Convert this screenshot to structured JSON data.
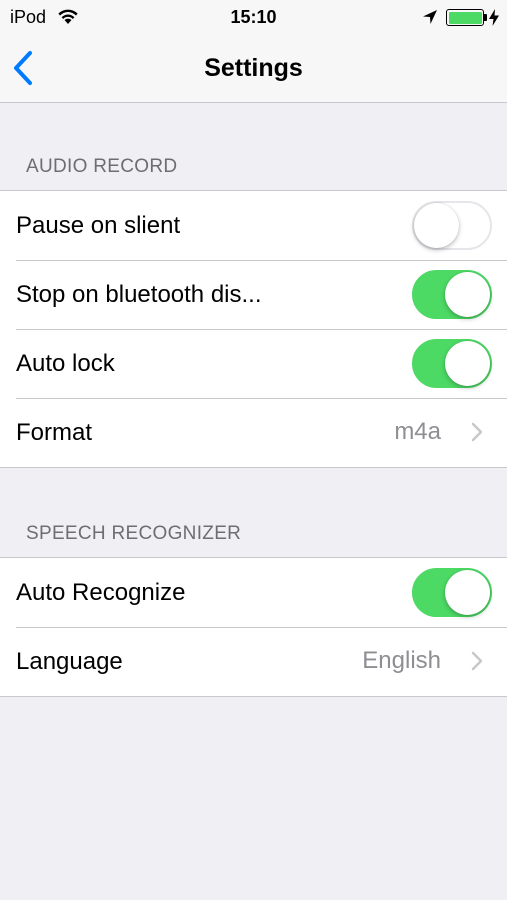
{
  "status_bar": {
    "carrier": "iPod",
    "time": "15:10",
    "battery_color": "#4cd964"
  },
  "nav": {
    "title": "Settings",
    "back_icon": "chevron-left-icon",
    "accent_color": "#007aff"
  },
  "sections": {
    "audio": {
      "header": "AUDIO RECORD",
      "rows": [
        {
          "label": "Pause on slient",
          "type": "toggle",
          "on": false
        },
        {
          "label": "Stop on bluetooth dis...",
          "type": "toggle",
          "on": true
        },
        {
          "label": "Auto lock",
          "type": "toggle",
          "on": true
        },
        {
          "label": "Format",
          "type": "disclosure",
          "value": "m4a"
        }
      ]
    },
    "speech": {
      "header": "SPEECH RECOGNIZER",
      "rows": [
        {
          "label": "Auto Recognize",
          "type": "toggle",
          "on": true
        },
        {
          "label": "Language",
          "type": "disclosure",
          "value": "English"
        }
      ]
    }
  },
  "colors": {
    "toggle_on": "#4cd964",
    "background": "#efeff4",
    "separator": "#c8c7cc",
    "value_text": "#8e8e93"
  }
}
